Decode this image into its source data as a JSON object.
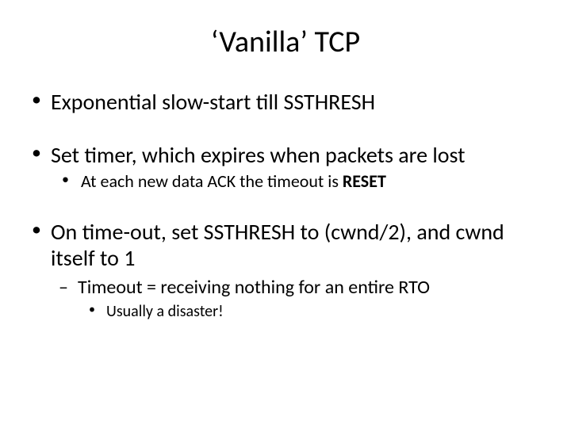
{
  "title": "‘Vanilla’ TCP",
  "bullets": {
    "b1": "Exponential slow-start till SSTHRESH",
    "b2": "Set timer, which expires when packets are lost",
    "b2_sub": "At each new data ACK the timeout is ",
    "b2_sub_bold": "RESET",
    "b3": "On time-out, set SSTHRESH to (cwnd/2), and cwnd itself to 1",
    "b3_sub": "Timeout = receiving nothing for an entire RTO",
    "b3_sub_sub": "Usually a disaster!"
  }
}
